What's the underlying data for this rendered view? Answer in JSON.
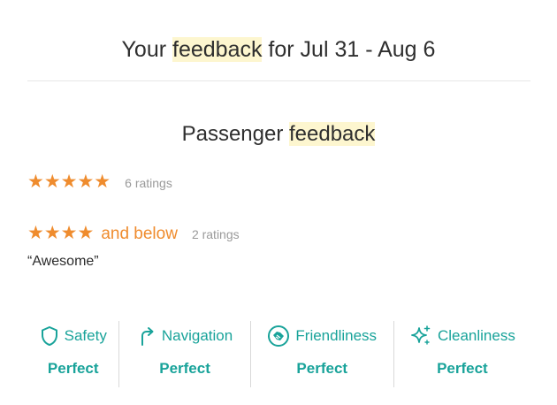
{
  "header": {
    "title_prefix": "Your ",
    "title_highlight": "feedback",
    "title_suffix": " for Jul 31 - Aug 6"
  },
  "passenger": {
    "title_prefix": "Passenger ",
    "title_highlight": "feedback",
    "five_star": {
      "stars": "★★★★★",
      "count_text": "6 ratings"
    },
    "four_below": {
      "stars": "★★★★",
      "label": "and below",
      "count_text": "2 ratings"
    },
    "comment": "“Awesome”"
  },
  "categories": [
    {
      "label": "Safety",
      "value": "Perfect",
      "icon": "shield-icon"
    },
    {
      "label": "Navigation",
      "value": "Perfect",
      "icon": "navigation-arrow-icon"
    },
    {
      "label": "Friendliness",
      "value": "Perfect",
      "icon": "handshake-icon"
    },
    {
      "label": "Cleanliness",
      "value": "Perfect",
      "icon": "sparkle-icon"
    }
  ],
  "colors": {
    "accent": "#19a39a",
    "star": "#ef8c2e",
    "highlight": "#fdf6cf"
  }
}
